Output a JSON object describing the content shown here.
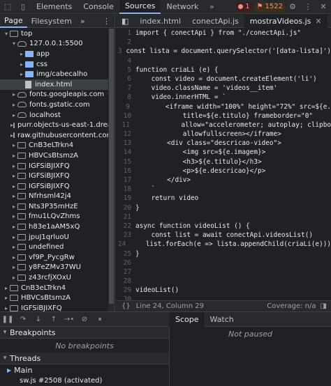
{
  "toolbar": {
    "tabs": [
      "Elements",
      "Console",
      "Sources",
      "Network"
    ],
    "active_tab": "Sources",
    "errors": "1",
    "warnings": "1522"
  },
  "navigator": {
    "tabs": [
      "Page",
      "Filesystem"
    ],
    "tree": [
      {
        "label": "top",
        "depth": 0,
        "icon": "frame",
        "arrow": "▾"
      },
      {
        "label": "127.0.0.1:5500",
        "depth": 1,
        "icon": "cloud",
        "arrow": "▾"
      },
      {
        "label": "app",
        "depth": 2,
        "icon": "folder",
        "arrow": "▸"
      },
      {
        "label": "css",
        "depth": 2,
        "icon": "folder",
        "arrow": "▸"
      },
      {
        "label": "img/cabecalho",
        "depth": 2,
        "icon": "folder",
        "arrow": "▸"
      },
      {
        "label": "index.html",
        "depth": 2,
        "icon": "file",
        "arrow": "",
        "selected": true
      },
      {
        "label": "fonts.googleapis.com",
        "depth": 1,
        "icon": "cloud",
        "arrow": "▸"
      },
      {
        "label": "fonts.gstatic.com",
        "depth": 1,
        "icon": "cloud",
        "arrow": "▸"
      },
      {
        "label": "localhost",
        "depth": 1,
        "icon": "cloud",
        "arrow": "▸"
      },
      {
        "label": "purr.objects-us-east-1.drea",
        "depth": 1,
        "icon": "cloud",
        "arrow": "▸"
      },
      {
        "label": "raw.githubusercontent.com",
        "depth": 1,
        "icon": "cloud",
        "arrow": "▸"
      },
      {
        "label": "CnB3eLTrkn4",
        "depth": 1,
        "icon": "frame",
        "arrow": "▸"
      },
      {
        "label": "HBVCsBtsmzA",
        "depth": 1,
        "icon": "frame",
        "arrow": "▸"
      },
      {
        "label": "IGFSiBJIXFQ",
        "depth": 1,
        "icon": "frame",
        "arrow": "▸"
      },
      {
        "label": "IGFSiBJIXFQ",
        "depth": 1,
        "icon": "frame",
        "arrow": "▸"
      },
      {
        "label": "IGFSiBJIXFQ",
        "depth": 1,
        "icon": "frame",
        "arrow": "▸"
      },
      {
        "label": "Nfrhsml42j4",
        "depth": 1,
        "icon": "frame",
        "arrow": "▸"
      },
      {
        "label": "Nts3P35mHzE",
        "depth": 1,
        "icon": "frame",
        "arrow": "▸"
      },
      {
        "label": "fmu1LQvZhms",
        "depth": 1,
        "icon": "frame",
        "arrow": "▸"
      },
      {
        "label": "h83e1aAM5xQ",
        "depth": 1,
        "icon": "frame",
        "arrow": "▸"
      },
      {
        "label": "jpuJ1qrluoU",
        "depth": 1,
        "icon": "frame",
        "arrow": "▸"
      },
      {
        "label": "undefined",
        "depth": 1,
        "icon": "frame",
        "arrow": "▸"
      },
      {
        "label": "vf9P_PycgRw",
        "depth": 1,
        "icon": "frame",
        "arrow": "▸"
      },
      {
        "label": "y8FeZMv37WU",
        "depth": 1,
        "icon": "frame",
        "arrow": "▸"
      },
      {
        "label": "z43rcfjXOxU",
        "depth": 1,
        "icon": "frame",
        "arrow": "▸"
      },
      {
        "label": "CnB3eLTrkn4",
        "depth": 0,
        "icon": "frame",
        "arrow": "▸"
      },
      {
        "label": "HBVCsBtsmzA",
        "depth": 0,
        "icon": "frame",
        "arrow": "▸"
      },
      {
        "label": "IGFSiBJIXFQ",
        "depth": 0,
        "icon": "frame",
        "arrow": "▸"
      }
    ]
  },
  "editor": {
    "tabs": [
      "index.html",
      "conectApi.js",
      "mostraVideos.js"
    ],
    "active_tab": "mostraVideos.js",
    "lines": [
      "import { conectApi } from \"./conectApi.js\"",
      "",
      "const lista = document.querySelector('[data-lista]')",
      "",
      "function criaLi (e) {",
      "    const video = document.createElement('li')",
      "    video.className = 'videos__item'",
      "    video.innerHTML = `",
      "        <iframe width=\"100%\" height=\"72%\" src=${e.",
      "            title=${e.titulo} frameborder=\"0\"",
      "            allow=\"accelerometer; autoplay; clipbo",
      "            allowfullscreen></iframe>",
      "        <div class=\"descricao-video\">",
      "            <img src=${e.imagem}>",
      "            <h3>${e.titulo}</h3>",
      "            <p>${e.descricao}</p>",
      "        </div>",
      "    `",
      "    return video",
      "}",
      "",
      "async function videoList () {",
      "    const list = await conectApi.videosList()",
      "    list.forEach(e => lista.appendChild(criaLi(e)))",
      "}",
      "",
      "",
      "",
      "videoList()",
      "",
      ""
    ],
    "status": "Line 24, Column 29",
    "coverage": "Coverage: n/a"
  },
  "debugger": {
    "breakpoints_label": "Breakpoints",
    "no_breakpoints": "No breakpoints",
    "threads_label": "Threads",
    "thread_main": "Main",
    "thread_sw": "sw.js #2508 (activated)"
  },
  "scope": {
    "tabs": [
      "Scope",
      "Watch"
    ],
    "not_paused": "Not paused"
  }
}
